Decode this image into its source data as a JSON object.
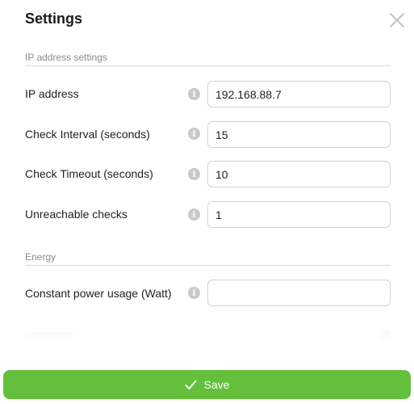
{
  "dialog": {
    "title": "Settings",
    "close_icon": "close-icon"
  },
  "sections": {
    "ip": {
      "title": "IP address settings",
      "fields": [
        {
          "label": "IP address",
          "value": "192.168.88.7"
        },
        {
          "label": "Check Interval (seconds)",
          "value": "15"
        },
        {
          "label": "Check Timeout (seconds)",
          "value": "10"
        },
        {
          "label": "Unreachable checks",
          "value": "1"
        }
      ]
    },
    "energy": {
      "title": "Energy",
      "fields": [
        {
          "label": "Constant power usage (Watt)",
          "value": ""
        }
      ]
    }
  },
  "info_icon": {
    "glyph": "i"
  },
  "footer": {
    "save_label": "Save",
    "save_icon": "checkmark-icon",
    "accent_color": "#63bf3c"
  }
}
